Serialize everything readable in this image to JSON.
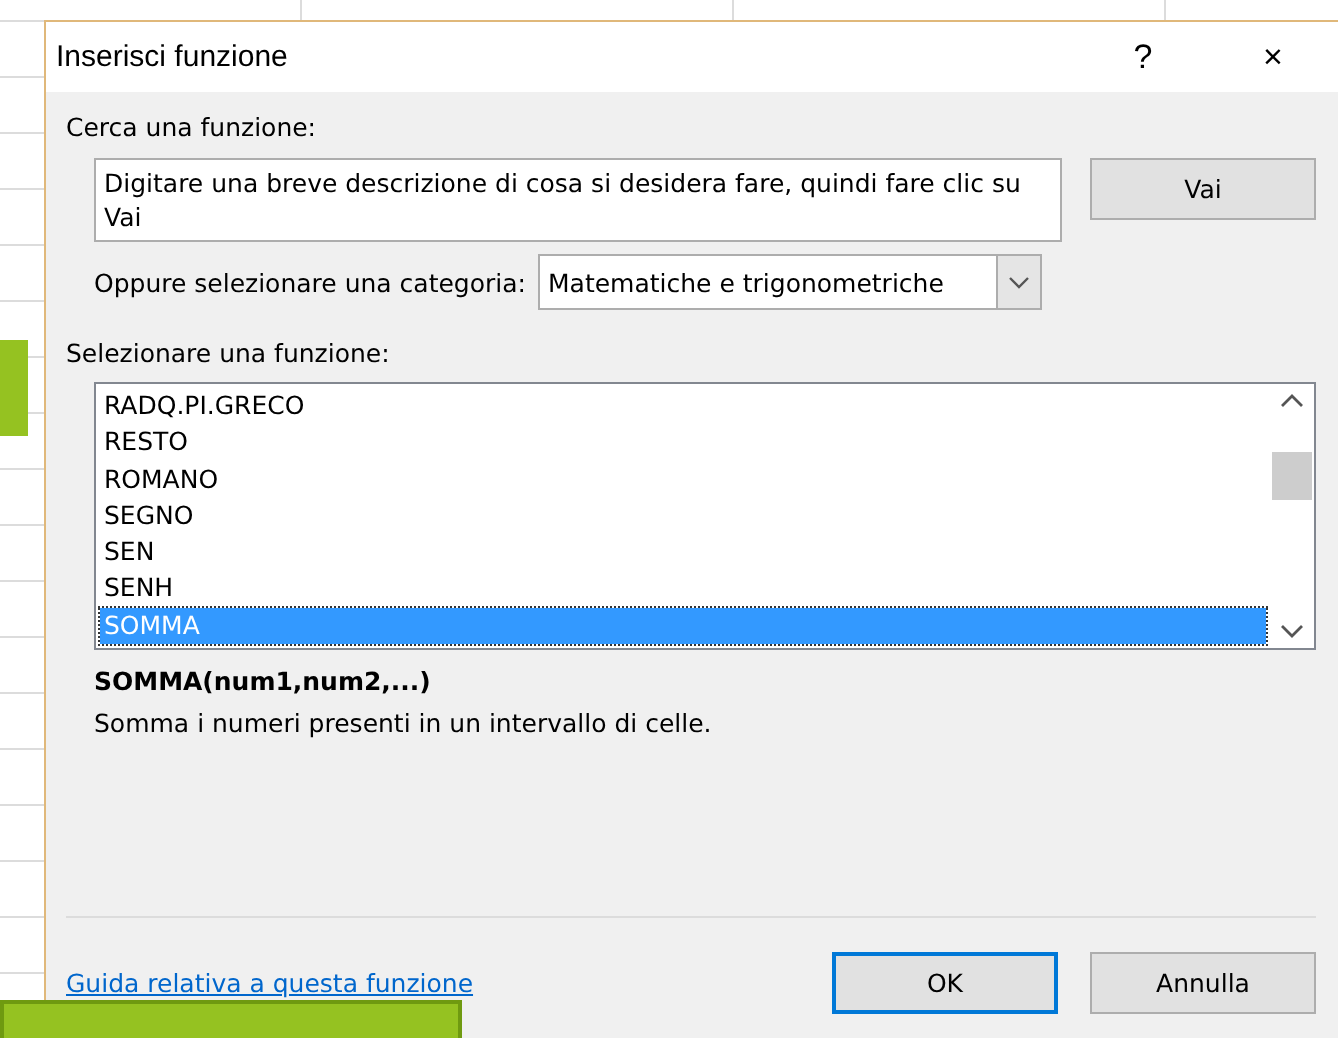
{
  "window": {
    "title": "Inserisci funzione",
    "help": "?",
    "close": "×"
  },
  "search": {
    "label": "Cerca una funzione:",
    "value": "Digitare una breve descrizione di cosa si desidera fare, quindi fare clic su Vai",
    "button": "Vai"
  },
  "category": {
    "label": "Oppure selezionare una categoria:",
    "value": "Matematiche e trigonometriche"
  },
  "functions": {
    "label": "Selezionare una funzione:",
    "items": [
      {
        "name": "RADQ.PI.GRECO",
        "selected": false
      },
      {
        "name": "RESTO",
        "selected": false
      },
      {
        "name": "ROMANO",
        "selected": false
      },
      {
        "name": "SEGNO",
        "selected": false
      },
      {
        "name": "SEN",
        "selected": false
      },
      {
        "name": "SENH",
        "selected": false
      },
      {
        "name": "SOMMA",
        "selected": true
      }
    ]
  },
  "signature": "SOMMA(num1,num2,...)",
  "description": "Somma i numeri presenti in un intervallo di celle.",
  "help_link": "Guida relativa a questa funzione",
  "buttons": [
    {
      "label": "OK",
      "default": true
    },
    {
      "label": "Annulla",
      "default": false
    }
  ]
}
